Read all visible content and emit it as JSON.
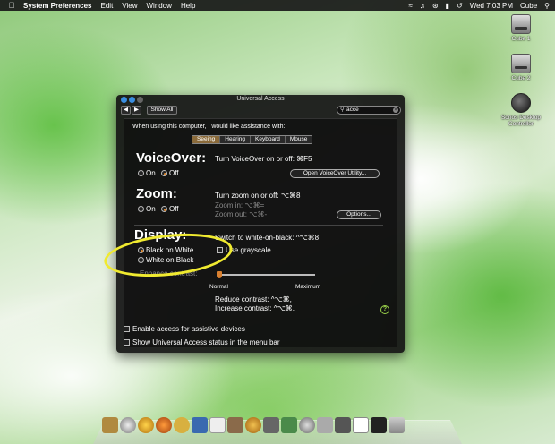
{
  "menubar": {
    "app_name": "System Preferences",
    "items": [
      "Edit",
      "View",
      "Window",
      "Help"
    ],
    "clock": "Wed 7:03 PM",
    "user": "Cube"
  },
  "desktop": {
    "icons": [
      {
        "label": "Cube 1"
      },
      {
        "label": "Cube 2"
      },
      {
        "label": "Sonos Desktop Controller"
      }
    ]
  },
  "window": {
    "title": "Universal Access",
    "show_all": "Show All",
    "search_value": "acce",
    "assist_label": "When using this computer, I would like assistance with:",
    "tabs": [
      "Seeing",
      "Hearing",
      "Keyboard",
      "Mouse"
    ],
    "active_tab": "Seeing",
    "voiceover": {
      "title": "VoiceOver:",
      "on": "On",
      "off": "Off",
      "shortcut": "Turn VoiceOver on or off: ⌘F5",
      "button": "Open VoiceOver Utility..."
    },
    "zoom": {
      "title": "Zoom:",
      "on": "On",
      "off": "Off",
      "shortcut": "Turn zoom on or off: ⌥⌘8",
      "zoom_in": "Zoom in: ⌥⌘=",
      "zoom_out": "Zoom out: ⌥⌘-",
      "button": "Options..."
    },
    "display": {
      "title": "Display:",
      "black_on_white": "Black on White",
      "white_on_black": "White on Black",
      "switch_shortcut": "Switch to white-on-black: ^⌥⌘8",
      "grayscale": "Use grayscale",
      "enhance_contrast": "Enhance contrast:",
      "normal": "Normal",
      "maximum": "Maximum",
      "contrast_level": 0,
      "reduce_contrast": "Reduce contrast: ^⌥⌘,",
      "increase_contrast": "Increase contrast: ^⌥⌘."
    },
    "enable_assistive": "Enable access for assistive devices",
    "show_status": "Show Universal Access status in the menu bar",
    "help": "?"
  },
  "colors": {
    "accent": "#e08a30",
    "highlight": "#f0ea30"
  }
}
